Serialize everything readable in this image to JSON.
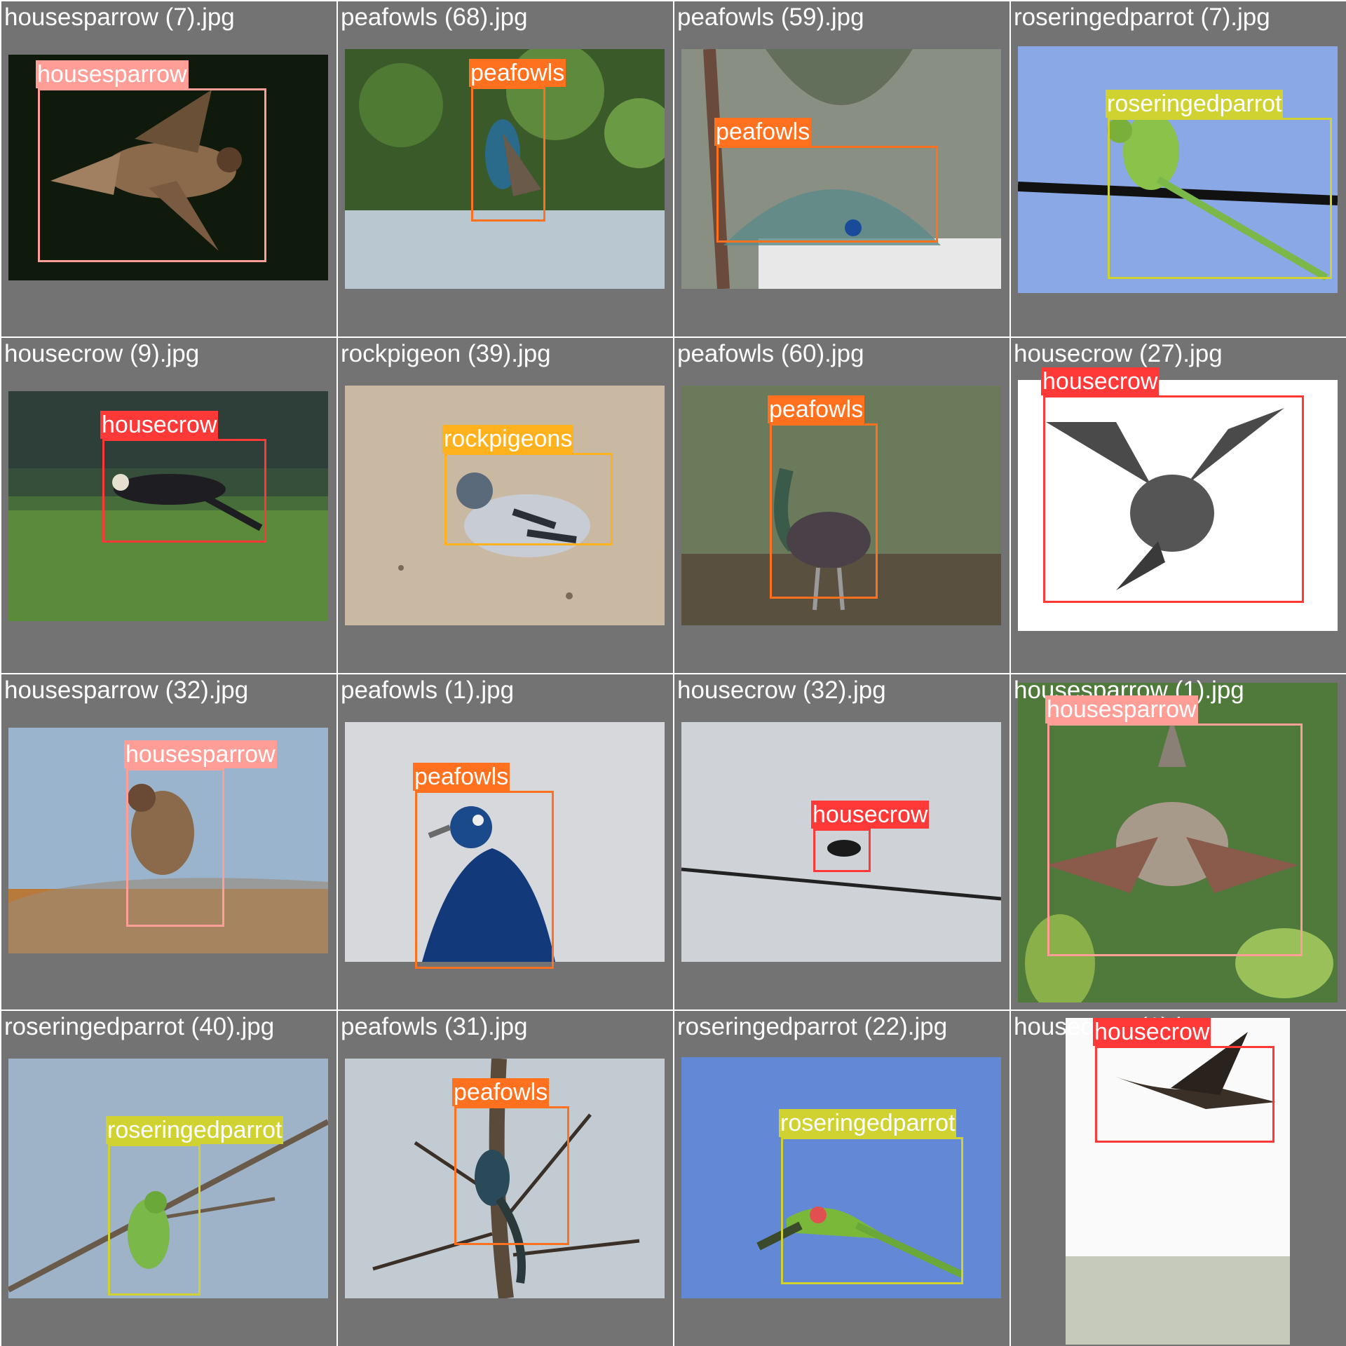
{
  "palette": {
    "housesparrow": "#ff9d97",
    "peafowls": "#ff701f",
    "roseringedparrot": "#cfd231",
    "housecrow": "#ff3838",
    "rockpigeons": "#ffb21d"
  },
  "tiles": [
    {
      "filename": "housesparrow (7).jpg",
      "label": "housesparrow",
      "cls": "housesparrow",
      "scene": "sparrow-dark"
    },
    {
      "filename": "peafowls (68).jpg",
      "label": "peafowls",
      "cls": "peafowls",
      "scene": "peacock-wall"
    },
    {
      "filename": "peafowls (59).jpg",
      "label": "peafowls",
      "cls": "peafowls",
      "scene": "peacock-palms"
    },
    {
      "filename": "roseringedparrot (7).jpg",
      "label": "roseringedparrot",
      "cls": "roseringedparrot",
      "scene": "parrot-wire"
    },
    {
      "filename": "housecrow (9).jpg",
      "label": "housecrow",
      "cls": "housecrow",
      "scene": "crow-field"
    },
    {
      "filename": "rockpigeon (39).jpg",
      "label": "rockpigeons",
      "cls": "rockpigeons",
      "scene": "pigeon-ground"
    },
    {
      "filename": "peafowls (60).jpg",
      "label": "peafowls",
      "cls": "peafowls",
      "scene": "peahen-grass"
    },
    {
      "filename": "housecrow (27).jpg",
      "label": "housecrow",
      "cls": "housecrow",
      "scene": "crow-white"
    },
    {
      "filename": "housesparrow (32).jpg",
      "label": "housesparrow",
      "cls": "housesparrow",
      "scene": "sparrow-rock"
    },
    {
      "filename": "peafowls (1).jpg",
      "label": "peafowls",
      "cls": "peafowls",
      "scene": "peacock-head"
    },
    {
      "filename": "housecrow (32).jpg",
      "label": "housecrow",
      "cls": "housecrow",
      "scene": "crow-wire"
    },
    {
      "filename": "housesparrow (1).jpg",
      "label": "housesparrow",
      "cls": "housesparrow",
      "scene": "sparrow-leaves"
    },
    {
      "filename": "roseringedparrot (40).jpg",
      "label": "roseringedparrot",
      "cls": "roseringedparrot",
      "scene": "parrot-branch"
    },
    {
      "filename": "peafowls (31).jpg",
      "label": "peafowls",
      "cls": "peafowls",
      "scene": "peacock-tree"
    },
    {
      "filename": "roseringedparrot (22).jpg",
      "label": "roseringedparrot",
      "cls": "roseringedparrot",
      "scene": "parrot-blue"
    },
    {
      "filename": "housecrow (1).jpg",
      "label": "housecrow",
      "cls": "housecrow",
      "scene": "crow-tall"
    }
  ]
}
